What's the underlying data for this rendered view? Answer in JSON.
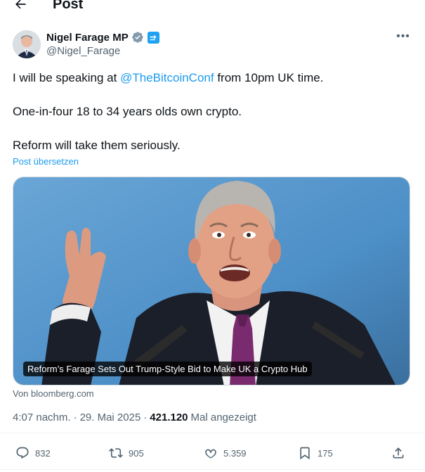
{
  "header": {
    "title": "Post",
    "back_icon": "arrow-left-icon"
  },
  "author": {
    "display_name": "Nigel Farage MP",
    "handle": "@Nigel_Farage",
    "verified_icon": "verified-badge-icon",
    "affiliation_icon": "affiliation-badge-icon"
  },
  "post": {
    "line1_pre": "I will be speaking at ",
    "line1_mention": "@TheBitcoinConf",
    "line1_post": " from 10pm UK time.",
    "line2": "One-in-four 18 to 34 years olds own crypto.",
    "line3": "Reform will take them seriously.",
    "translate_label": "Post übersetzen"
  },
  "card": {
    "caption": "Reform’s Farage Sets Out Trump-Style Bid to Make UK a Crypto Hub",
    "source": "Von bloomberg.com"
  },
  "meta": {
    "time": "4:07 nachm.",
    "separator": "·",
    "date": "29. Mai 2025",
    "views": "421.120",
    "views_label": "Mal angezeigt"
  },
  "actions": {
    "replies": "832",
    "reposts": "905",
    "likes": "5.359",
    "bookmarks": "175"
  },
  "colors": {
    "accent": "#1d9bf0",
    "muted": "#536471",
    "text": "#0f1419"
  }
}
